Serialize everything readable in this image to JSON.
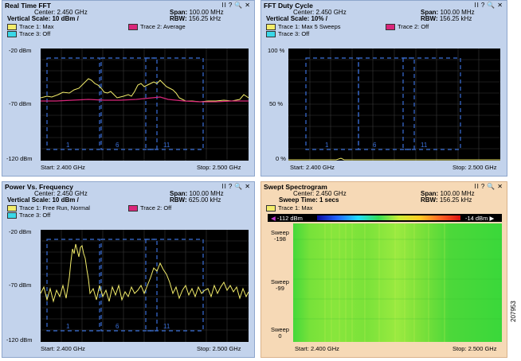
{
  "panels": [
    {
      "title": "Real Time FFT",
      "center": "Center: 2.450 GHz",
      "span_label": "Span:",
      "span_value": "100.00 MHz",
      "vscale": "Vertical Scale: 10 dBm /",
      "rbw_label": "RBW:",
      "rbw_value": "156.25 kHz",
      "trace1": "Trace 1: Max",
      "trace2": "Trace 2: Average",
      "trace3": "Trace 3: Off",
      "y_top": "-20 dBm",
      "y_mid": "-70 dBm",
      "y_bot": "-120 dBm",
      "start": "Start: 2.400 GHz",
      "stop": "Stop: 2.500 GHz",
      "channels": [
        "1",
        "6",
        "11"
      ]
    },
    {
      "title": "FFT Duty Cycle",
      "center": "Center: 2.450 GHz",
      "span_label": "Span:",
      "span_value": "100.00 MHz",
      "vscale": "Vertical Scale: 10% /",
      "rbw_label": "RBW:",
      "rbw_value": "156.25 kHz",
      "trace1": "Trace 1: Max 5 Sweeps",
      "trace2": "Trace 2: Off",
      "trace3": "Trace 3: Off",
      "y_top": "100 %",
      "y_mid": "50 %",
      "y_bot": "0 %",
      "start": "Start: 2.400 GHz",
      "stop": "Stop: 2.500 GHz",
      "channels": [
        "1",
        "6",
        "11"
      ]
    },
    {
      "title": "Power Vs. Frequency",
      "center": "Center: 2.450 GHz",
      "span_label": "Span:",
      "span_value": "100.00 MHz",
      "vscale": "Vertical Scale: 10 dBm /",
      "rbw_label": "RBW:",
      "rbw_value": "625.00 kHz",
      "trace1": "Trace 1: Free Run, Normal",
      "trace2": "Trace 2: Off",
      "trace3": "Trace 3: Off",
      "y_top": "-20 dBm",
      "y_mid": "-70 dBm",
      "y_bot": "-120 dBm",
      "start": "Start: 2.400 GHz",
      "stop": "Stop: 2.500 GHz",
      "channels": [
        "1",
        "6",
        "11"
      ]
    },
    {
      "title": "Swept Spectrogram",
      "center": "Center: 2.450 GHz",
      "span_label": "Span:",
      "span_value": "100.00 MHz",
      "sweep_time": "Sweep Time: 1 secs",
      "rbw_label": "RBW:",
      "rbw_value": "156.25 kHz",
      "trace1": "Trace 1: Max",
      "scale_min": "-112 dBm",
      "scale_max": "-14 dBm",
      "y_top_a": "Sweep",
      "y_top_b": "-198",
      "y_mid_a": "Sweep",
      "y_mid_b": "-99",
      "y_bot_a": "Sweep",
      "y_bot_b": "0",
      "start": "Start: 2.400 GHz",
      "stop": "Stop: 2.500 GHz"
    }
  ],
  "controls": [
    "II",
    "?",
    "🔍",
    "✕"
  ],
  "figure_code": "207953",
  "colors": {
    "panel_bg": "#c3d3ec",
    "active_bg": "#f6d9b6",
    "trace1": "#f2ec6a",
    "trace2": "#d9267a",
    "trace3": "#39d7e8",
    "channel_box": "#3a6fd8",
    "spectro_bg": "#3ad83a"
  }
}
